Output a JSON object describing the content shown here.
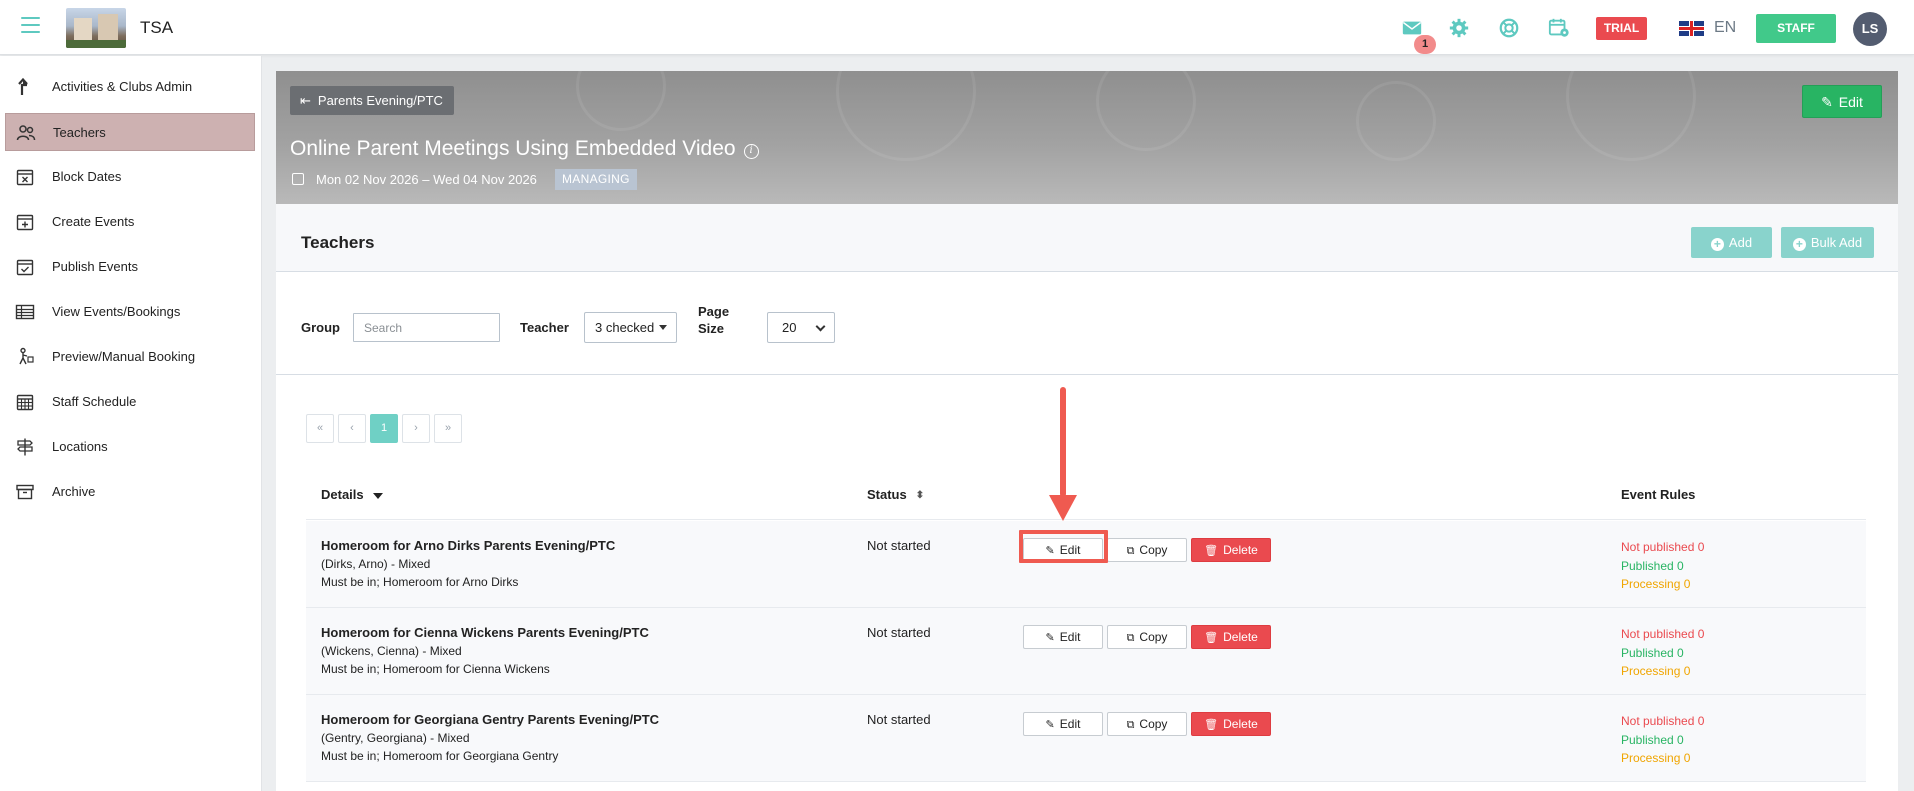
{
  "app": {
    "name": "TSA"
  },
  "topbar": {
    "notification_count": "1",
    "trial_label": "TRIAL",
    "language": "EN",
    "staff_label": "STAFF",
    "user_initials": "LS"
  },
  "sidebar": {
    "items": [
      {
        "label": "Activities & Clubs Admin",
        "icon": "arrow-up-turn-icon"
      },
      {
        "label": "Teachers",
        "icon": "people-icon",
        "active": true
      },
      {
        "label": "Block Dates",
        "icon": "calendar-x-icon"
      },
      {
        "label": "Create Events",
        "icon": "calendar-plus-icon"
      },
      {
        "label": "Publish Events",
        "icon": "calendar-check-icon"
      },
      {
        "label": "View Events/Bookings",
        "icon": "table-icon"
      },
      {
        "label": "Preview/Manual Booking",
        "icon": "person-walk-icon"
      },
      {
        "label": "Staff Schedule",
        "icon": "calendar-grid-icon"
      },
      {
        "label": "Locations",
        "icon": "signpost-icon"
      },
      {
        "label": "Archive",
        "icon": "archive-box-icon"
      }
    ]
  },
  "banner": {
    "back_label": "Parents Evening/PTC",
    "edit_label": "Edit",
    "title": "Online Parent Meetings Using Embedded Video",
    "dates": "Mon 02 Nov 2026 – Wed 04 Nov 2026",
    "status_tag": "MANAGING"
  },
  "panel": {
    "title": "Teachers",
    "add_label": "Add",
    "bulk_add_label": "Bulk Add"
  },
  "filters": {
    "group_label": "Group",
    "search_placeholder": "Search",
    "teacher_label": "Teacher",
    "teacher_value": "3 checked",
    "page_size_label_1": "Page",
    "page_size_label_2": "Size",
    "page_size_value": "20"
  },
  "pager": {
    "first": "«",
    "prev": "‹",
    "current": "1",
    "next": "›",
    "last": "»"
  },
  "table": {
    "columns": {
      "details": "Details",
      "status": "Status",
      "rules": "Event Rules"
    },
    "actions": {
      "edit": "Edit",
      "copy": "Copy",
      "delete": "Delete"
    },
    "rows": [
      {
        "name": "Homeroom for Arno Dirks Parents Evening/PTC",
        "sub1": "(Dirks, Arno) - Mixed",
        "sub2": "Must be in; Homeroom for Arno Dirks",
        "status": "Not started",
        "not_published": "Not published 0",
        "published": "Published 0",
        "processing": "Processing 0"
      },
      {
        "name": "Homeroom for Cienna Wickens Parents Evening/PTC",
        "sub1": "(Wickens, Cienna) - Mixed",
        "sub2": "Must be in; Homeroom for Cienna Wickens",
        "status": "Not started",
        "not_published": "Not published 0",
        "published": "Published 0",
        "processing": "Processing 0"
      },
      {
        "name": "Homeroom for Georgiana Gentry Parents Evening/PTC",
        "sub1": "(Gentry, Georgiana) - Mixed",
        "sub2": "Must be in; Homeroom for Georgiana Gentry",
        "status": "Not started",
        "not_published": "Not published 0",
        "published": "Published 0",
        "processing": "Processing 0"
      }
    ]
  },
  "colors": {
    "accent": "#5ec9c0",
    "active_sidebar": "#cdb1b1",
    "danger": "#ea4a4f",
    "success": "#28b463",
    "warning": "#f0a500",
    "annotation": "#ef5a50"
  }
}
